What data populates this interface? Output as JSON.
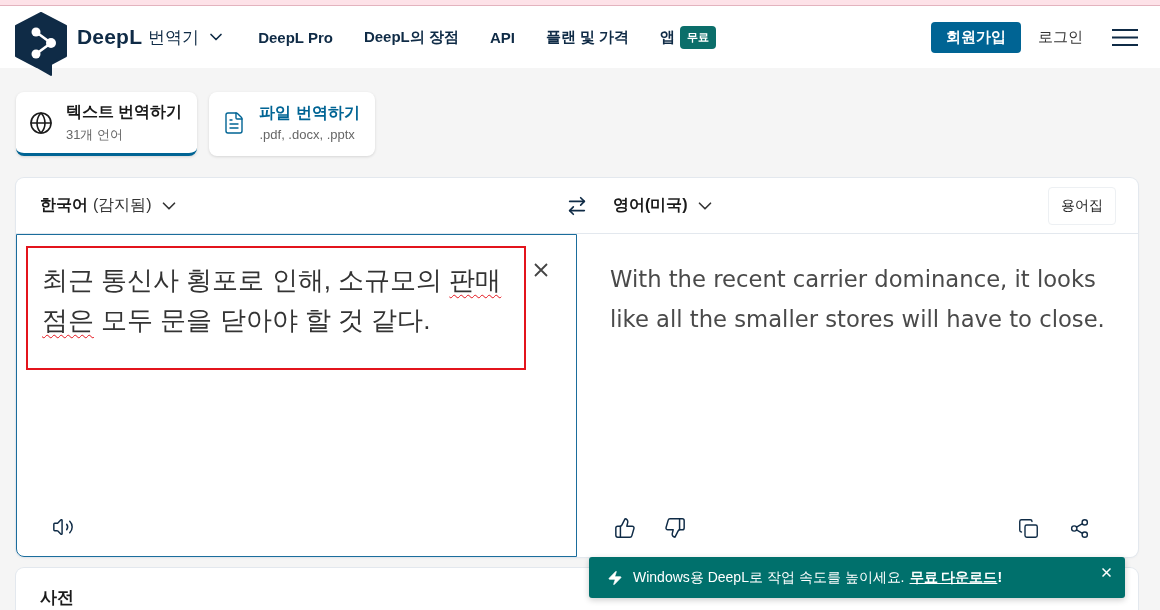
{
  "header": {
    "brand": "DeepL",
    "product_menu": "번역기",
    "nav": [
      {
        "label": "DeepL Pro"
      },
      {
        "label": "DeepL의 장점"
      },
      {
        "label": "API"
      },
      {
        "label": "플랜 및 가격"
      },
      {
        "label": "앱",
        "badge": "무료"
      }
    ],
    "signup_button": "회원가입",
    "login_link": "로그인"
  },
  "mode_tabs": [
    {
      "kind": "text",
      "title": "텍스트 번역하기",
      "subtitle": "31개 언어",
      "selected": true
    },
    {
      "kind": "file",
      "title": "파일 번역하기",
      "subtitle": ".pdf, .docx, .pptx",
      "selected": false
    }
  ],
  "translator": {
    "source_language": "한국어",
    "source_language_note": "(감지됨)",
    "target_language": "영어(미국)",
    "glossary_button": "용어집",
    "source": {
      "annotated": true,
      "segments": [
        {
          "text": "최근 통신사 횡포로 인해, 소규모의 ",
          "flagged": false
        },
        {
          "text": "판매점은",
          "flagged": true
        },
        {
          "text": " 모두 문을 닫아야 할 것 같다.",
          "flagged": false
        }
      ]
    },
    "translation": "With the recent carrier dominance, it looks like all the smaller stores will have to close."
  },
  "dictionary": {
    "title": "사전"
  },
  "toast": {
    "message": "Windows용 DeepL로 작업 속도를 높이세요.",
    "link": "무료 다운로드",
    "link_suffix": "!"
  }
}
